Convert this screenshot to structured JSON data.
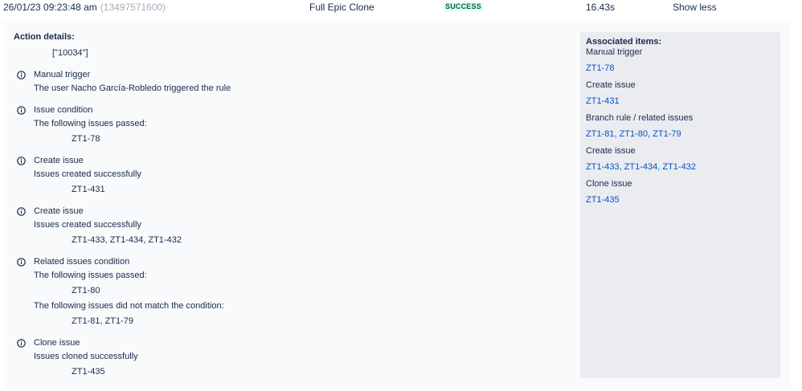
{
  "header": {
    "timestamp": "26/01/23 09:23:48 am",
    "audit_id": "(13497571600)",
    "rule_name": "Full Epic Clone",
    "status": "SUCCESS",
    "duration": "16.43s",
    "toggle_label": "Show less"
  },
  "details": {
    "title": "Action details:",
    "action_value": "[\"10034\"]",
    "events": [
      {
        "icon": "info-icon",
        "title": "Manual trigger",
        "lines": [
          "The user Nacho García-Robledo triggered the rule"
        ]
      },
      {
        "icon": "info-icon",
        "title": "Issue condition",
        "lines": [
          "The following issues passed:",
          "ZT1-78"
        ]
      },
      {
        "icon": "info-icon",
        "title": "Create issue",
        "lines": [
          "Issues created successfully",
          "ZT1-431"
        ]
      },
      {
        "icon": "info-icon",
        "title": "Create issue",
        "lines": [
          "Issues created successfully",
          "ZT1-433, ZT1-434, ZT1-432"
        ]
      },
      {
        "icon": "info-icon",
        "title": "Related issues condition",
        "lines": [
          "The following issues passed:",
          "ZT1-80",
          "The following issues did not match the condition:",
          "ZT1-81, ZT1-79"
        ]
      },
      {
        "icon": "info-icon",
        "title": "Clone issue",
        "lines": [
          "Issues cloned successfully",
          "ZT1-435"
        ]
      }
    ]
  },
  "associated": {
    "title": "Associated items:",
    "groups": [
      {
        "label": "Manual trigger",
        "links": "ZT1-78"
      },
      {
        "label": "Create issue",
        "links": "ZT1-431"
      },
      {
        "label": "Branch rule / related issues",
        "links": "ZT1-81, ZT1-80, ZT1-79"
      },
      {
        "label": "Create issue",
        "links": "ZT1-433, ZT1-434, ZT1-432"
      },
      {
        "label": "Clone issue",
        "links": "ZT1-435"
      }
    ]
  },
  "colors": {
    "text": "#172b4d",
    "link": "#0052cc",
    "status_text": "#006644",
    "status_bg": "#e3fcef",
    "muted": "#a5adba",
    "panel_bg": "#f9fafb",
    "associated_bg": "#ebecf0"
  }
}
